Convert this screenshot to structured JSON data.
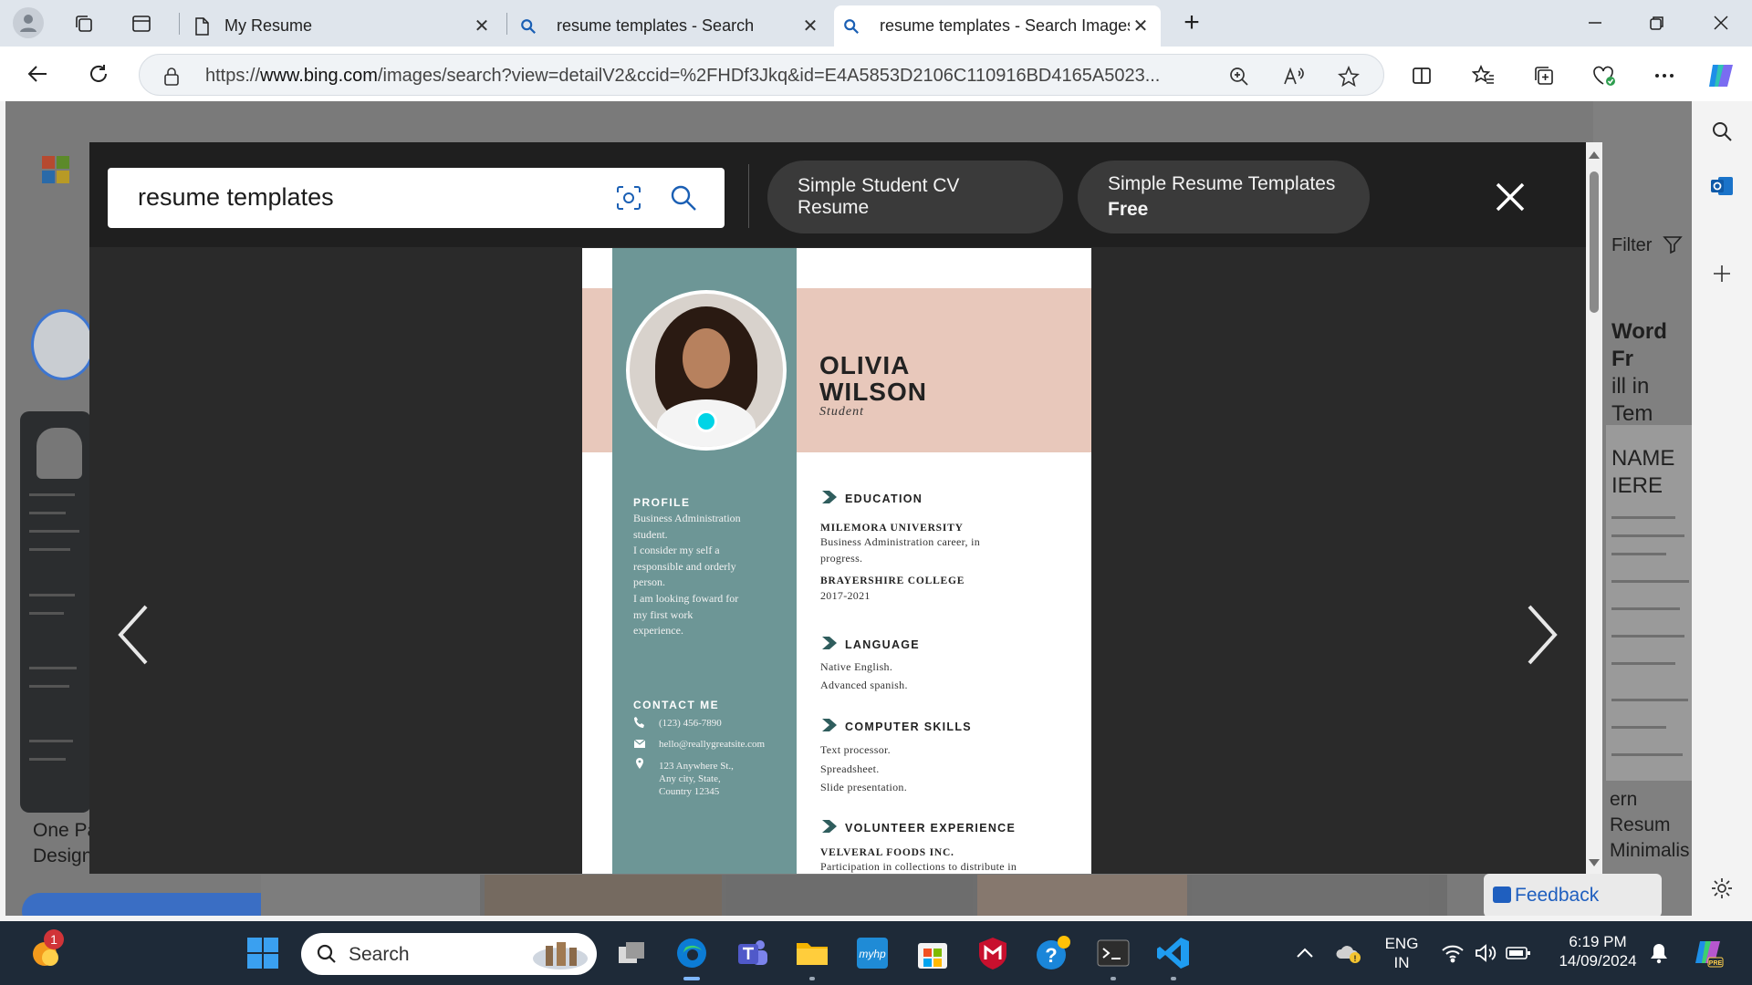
{
  "tabs": [
    {
      "label": "My Resume",
      "close": "✕"
    },
    {
      "label": "resume templates - Search",
      "close": "✕"
    },
    {
      "label": "resume templates - Search Images",
      "close": "✕"
    }
  ],
  "newtab": "+",
  "address": {
    "url_prefix": "https://",
    "url_host": "www.bing.com",
    "url_path": "/images/search?view=detailV2&ccid=%2FHDf3Jkq&id=E4A5853D2106C110916BD4165A5023..."
  },
  "background": {
    "filter_label": "Filter",
    "right_card_title_1": "Word Fr",
    "right_card_title_2": "ill in Tem",
    "right_card_2_1": "NAME",
    "right_card_2_2": "IERE",
    "right_caption_1": "ern Resum",
    "right_caption_2": "Minimalis",
    "left_caption_1": "One Pa",
    "left_caption_2": "Design",
    "feedback": "Feedback"
  },
  "viewer": {
    "query": "resume templates",
    "chips": [
      {
        "title": "Simple Student CV Resume",
        "sub": ""
      },
      {
        "title": "Simple Resume Templates",
        "sub": "Free"
      }
    ]
  },
  "resume": {
    "name_line1": "OLIVIA",
    "name_line2": "WILSON",
    "role": "Student",
    "profile_heading": "PROFILE",
    "profile_lines": [
      "Business Administration",
      "student.",
      "I consider my self a",
      "responsible and orderly",
      "person.",
      "I am looking foward for",
      "my first work",
      "experience."
    ],
    "contact_heading": "CONTACT ME",
    "phone": "(123) 456-7890",
    "email": "hello@reallygreatsite.com",
    "address_lines": [
      "123 Anywhere St.,",
      "Any city, State,",
      "Country 12345"
    ],
    "education_heading": "EDUCATION",
    "edu1_school": "MILEMORA UNIVERSITY",
    "edu1_lines": [
      "Business Administration career, in",
      "progress."
    ],
    "edu2_school": "BRAYERSHIRE COLLEGE",
    "edu2_years": "2017-2021",
    "language_heading": "LANGUAGE",
    "language_lines": [
      "Native English.",
      "Advanced spanish."
    ],
    "skills_heading": "COMPUTER SKILLS",
    "skills_lines": [
      "Text processor.",
      "Spreadsheet.",
      "Slide presentation."
    ],
    "volunteer_heading": "VOLUNTEER EXPERIENCE",
    "volunteer_org": "VELVERAL FOODS INC.",
    "volunteer_line": "Participation in collections to distribute in"
  },
  "taskbar": {
    "notification_count": "1",
    "search_label": "Search",
    "lang_1": "ENG",
    "lang_2": "IN",
    "time": "6:19 PM",
    "date": "14/09/2024"
  },
  "colors": {
    "accent": "#0078d4",
    "resume_teal": "#6d9696",
    "resume_peach": "#e8c8bb",
    "marker": "#00d4e6"
  }
}
